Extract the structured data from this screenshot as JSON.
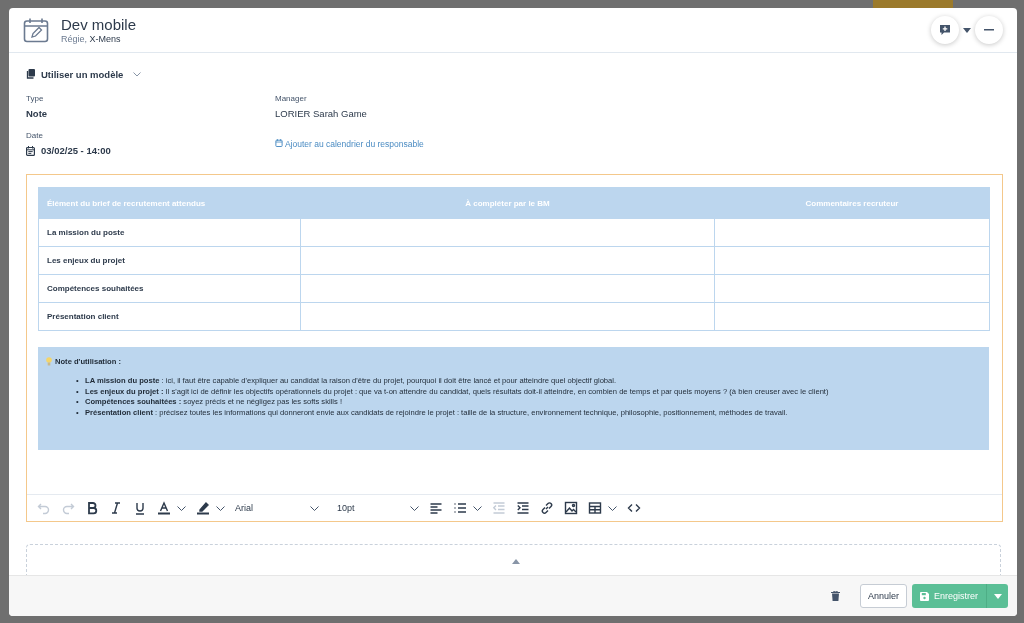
{
  "header": {
    "title": "Dev mobile",
    "subtitle_prefix": "Régie, ",
    "subtitle_client": "X-Mens"
  },
  "template": {
    "label": "Utiliser un modèle"
  },
  "fields": [
    {
      "label": "Type",
      "value": "Note"
    },
    {
      "label": "Manager",
      "value": "LORIER Sarah Game"
    }
  ],
  "date": {
    "label": "Date",
    "value": "03/02/25 - 14:00",
    "link": "Ajouter au calendrier du responsable"
  },
  "table": {
    "columns": [
      "Élément du brief de recrutement attendus",
      "À compléter par le BM",
      "Commentaires recruteur"
    ],
    "rows": [
      [
        "La mission du poste",
        "",
        ""
      ],
      [
        "Les enjeux du projet",
        "",
        ""
      ],
      [
        "Compétences souhaitées",
        "",
        ""
      ],
      [
        "Présentation client",
        "",
        ""
      ]
    ]
  },
  "note": {
    "title": "Note d'utilisation :",
    "items": [
      {
        "marker": "•",
        "text": "**LA mission du poste** : ici, il faut être capable d'expliquer au candidat la raison d'être du projet, pourquoi il doit être lancé et pour atteindre quel objectif global."
      },
      {
        "marker": "•",
        "text": "**Les enjeux du projet :** Il s'agit ici de définir les objectifs opérationnels du projet : que va t-on attendre du candidat, quels résultats doit-il atteindre, en combien de temps et par quels moyens ? (à bien creuser avec le client)"
      },
      {
        "marker": "•",
        "text": "**Compétences souhaitées :** soyez précis et ne négligez pas les softs skills !"
      },
      {
        "marker": "•",
        "text": "**Présentation client** : précisez toutes les informations qui donneront envie aux candidats de rejoindre le projet : taille de la structure, environnement technique, philosophie, positionnement, méthodes de travail."
      }
    ]
  },
  "toolbar": [
    {
      "kind": "undo",
      "disabled": true
    },
    {
      "kind": "redo",
      "disabled": true
    },
    {
      "kind": "bold",
      "disabled": false
    },
    {
      "kind": "italic",
      "disabled": false
    },
    {
      "kind": "underline",
      "disabled": false
    },
    {
      "kind": "text-color",
      "disabled": false
    },
    {
      "kind": "highlight",
      "disabled": false
    },
    {
      "kind": "font",
      "value": "Arial"
    },
    {
      "kind": "size",
      "value": "10pt"
    },
    {
      "kind": "align",
      "disabled": false
    },
    {
      "kind": "list",
      "disabled": false
    },
    {
      "kind": "outdent",
      "disabled": true
    },
    {
      "kind": "indent",
      "disabled": false
    },
    {
      "kind": "link",
      "disabled": false
    },
    {
      "kind": "image",
      "disabled": false
    },
    {
      "kind": "table",
      "disabled": false
    },
    {
      "kind": "code",
      "disabled": false
    }
  ],
  "footer": {
    "cancel": "Annuler",
    "save": "Enregistrer"
  }
}
